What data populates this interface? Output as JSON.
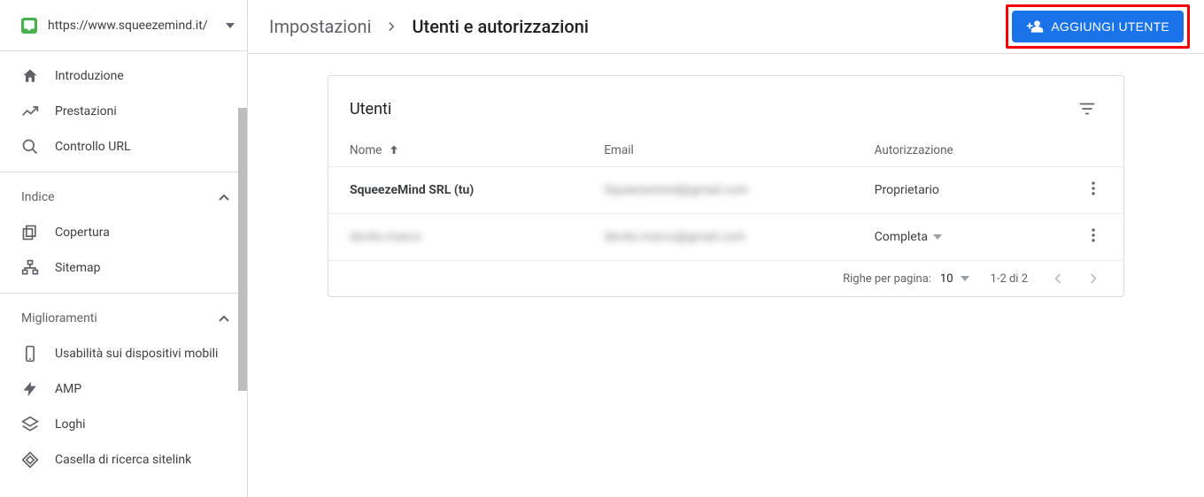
{
  "property": {
    "url": "https://www.squeezemind.it/"
  },
  "sidebar": {
    "items_a": [
      {
        "label": "Introduzione"
      },
      {
        "label": "Prestazioni"
      },
      {
        "label": "Controllo URL"
      }
    ],
    "section_index": "Indice",
    "items_b": [
      {
        "label": "Copertura"
      },
      {
        "label": "Sitemap"
      }
    ],
    "section_enh": "Miglioramenti",
    "items_c": [
      {
        "label": "Usabilità sui dispositivi mobili"
      },
      {
        "label": "AMP"
      },
      {
        "label": "Loghi"
      },
      {
        "label": "Casella di ricerca sitelink"
      }
    ]
  },
  "breadcrumb": {
    "root": "Impostazioni",
    "current": "Utenti e autorizzazioni"
  },
  "buttons": {
    "add_user": "AGGIUNGI UTENTE"
  },
  "card": {
    "title": "Utenti",
    "columns": {
      "name": "Nome",
      "email": "Email",
      "auth": "Autorizzazione"
    },
    "rows": [
      {
        "name": "SqueezeMind SRL (tu)",
        "email": "Squeezemind@gmail.com",
        "auth": "Proprietario",
        "auth_dropdown": false
      },
      {
        "name": "devito.marco",
        "email": "devito.marco@gmail.com",
        "auth": "Completa",
        "auth_dropdown": true,
        "blur_name": true
      }
    ],
    "pager": {
      "label": "Righe per pagina:",
      "size": "10",
      "range": "1-2 di 2"
    }
  }
}
